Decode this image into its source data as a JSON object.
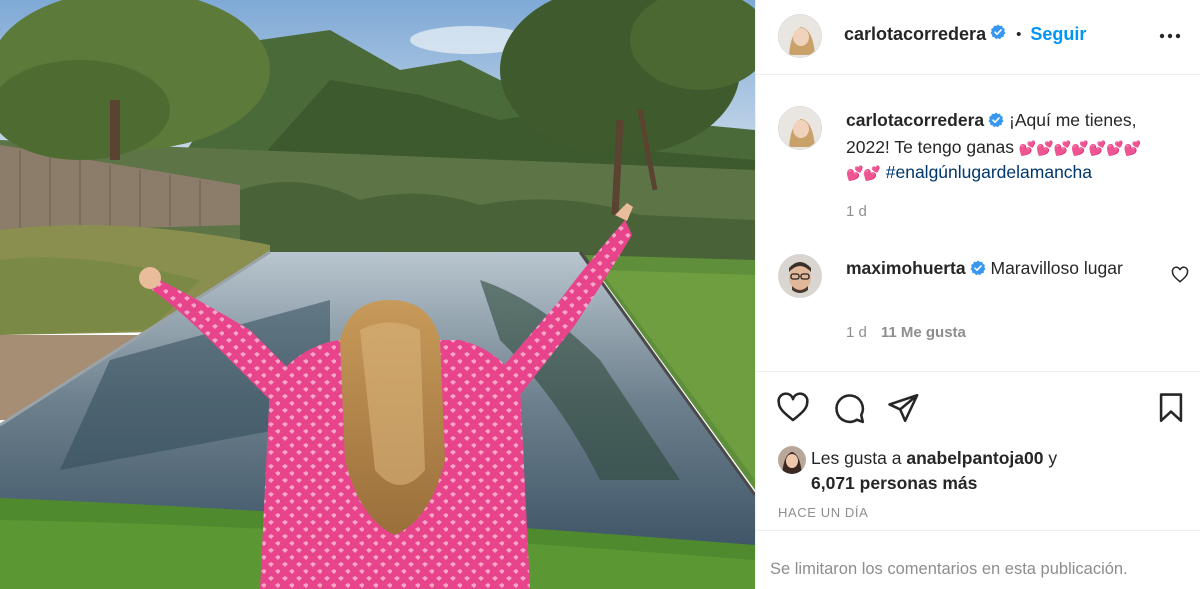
{
  "post": {
    "photo": {
      "description_icon": "photo-image"
    },
    "header": {
      "username": "carlotacorredera",
      "separator": "•",
      "follow_label": "Seguir",
      "more_icon": "more-options-icon"
    },
    "caption": {
      "username": "carlotacorredera",
      "text_line1": "¡Aquí me tienes,",
      "text_line2": "2022! Te tengo ganas",
      "hearts_line2": "💕💕💕💕💕💕💕",
      "hearts_line3": "💕💕",
      "hashtag": "#enalgúnlugardelamancha",
      "age": "1 d"
    },
    "comment": {
      "username": "maximohuerta",
      "text": "Maravilloso lugar",
      "age": "1 d",
      "likes": "11 Me gusta"
    },
    "likes": {
      "prefix": "Les gusta a",
      "liker": "anabelpantoja00",
      "conjunction": "y",
      "others": "6,071 personas más"
    },
    "timestamp": "HACE UN DÍA",
    "comments_limited": "Se limitaron los comentarios en esta publicación.",
    "colors": {
      "text": "#262626",
      "secondary": "#8e8e8e",
      "link_blue": "#0095f6",
      "hashtag": "#00376b",
      "verified": "#3897f0",
      "divider": "#efefef"
    }
  }
}
